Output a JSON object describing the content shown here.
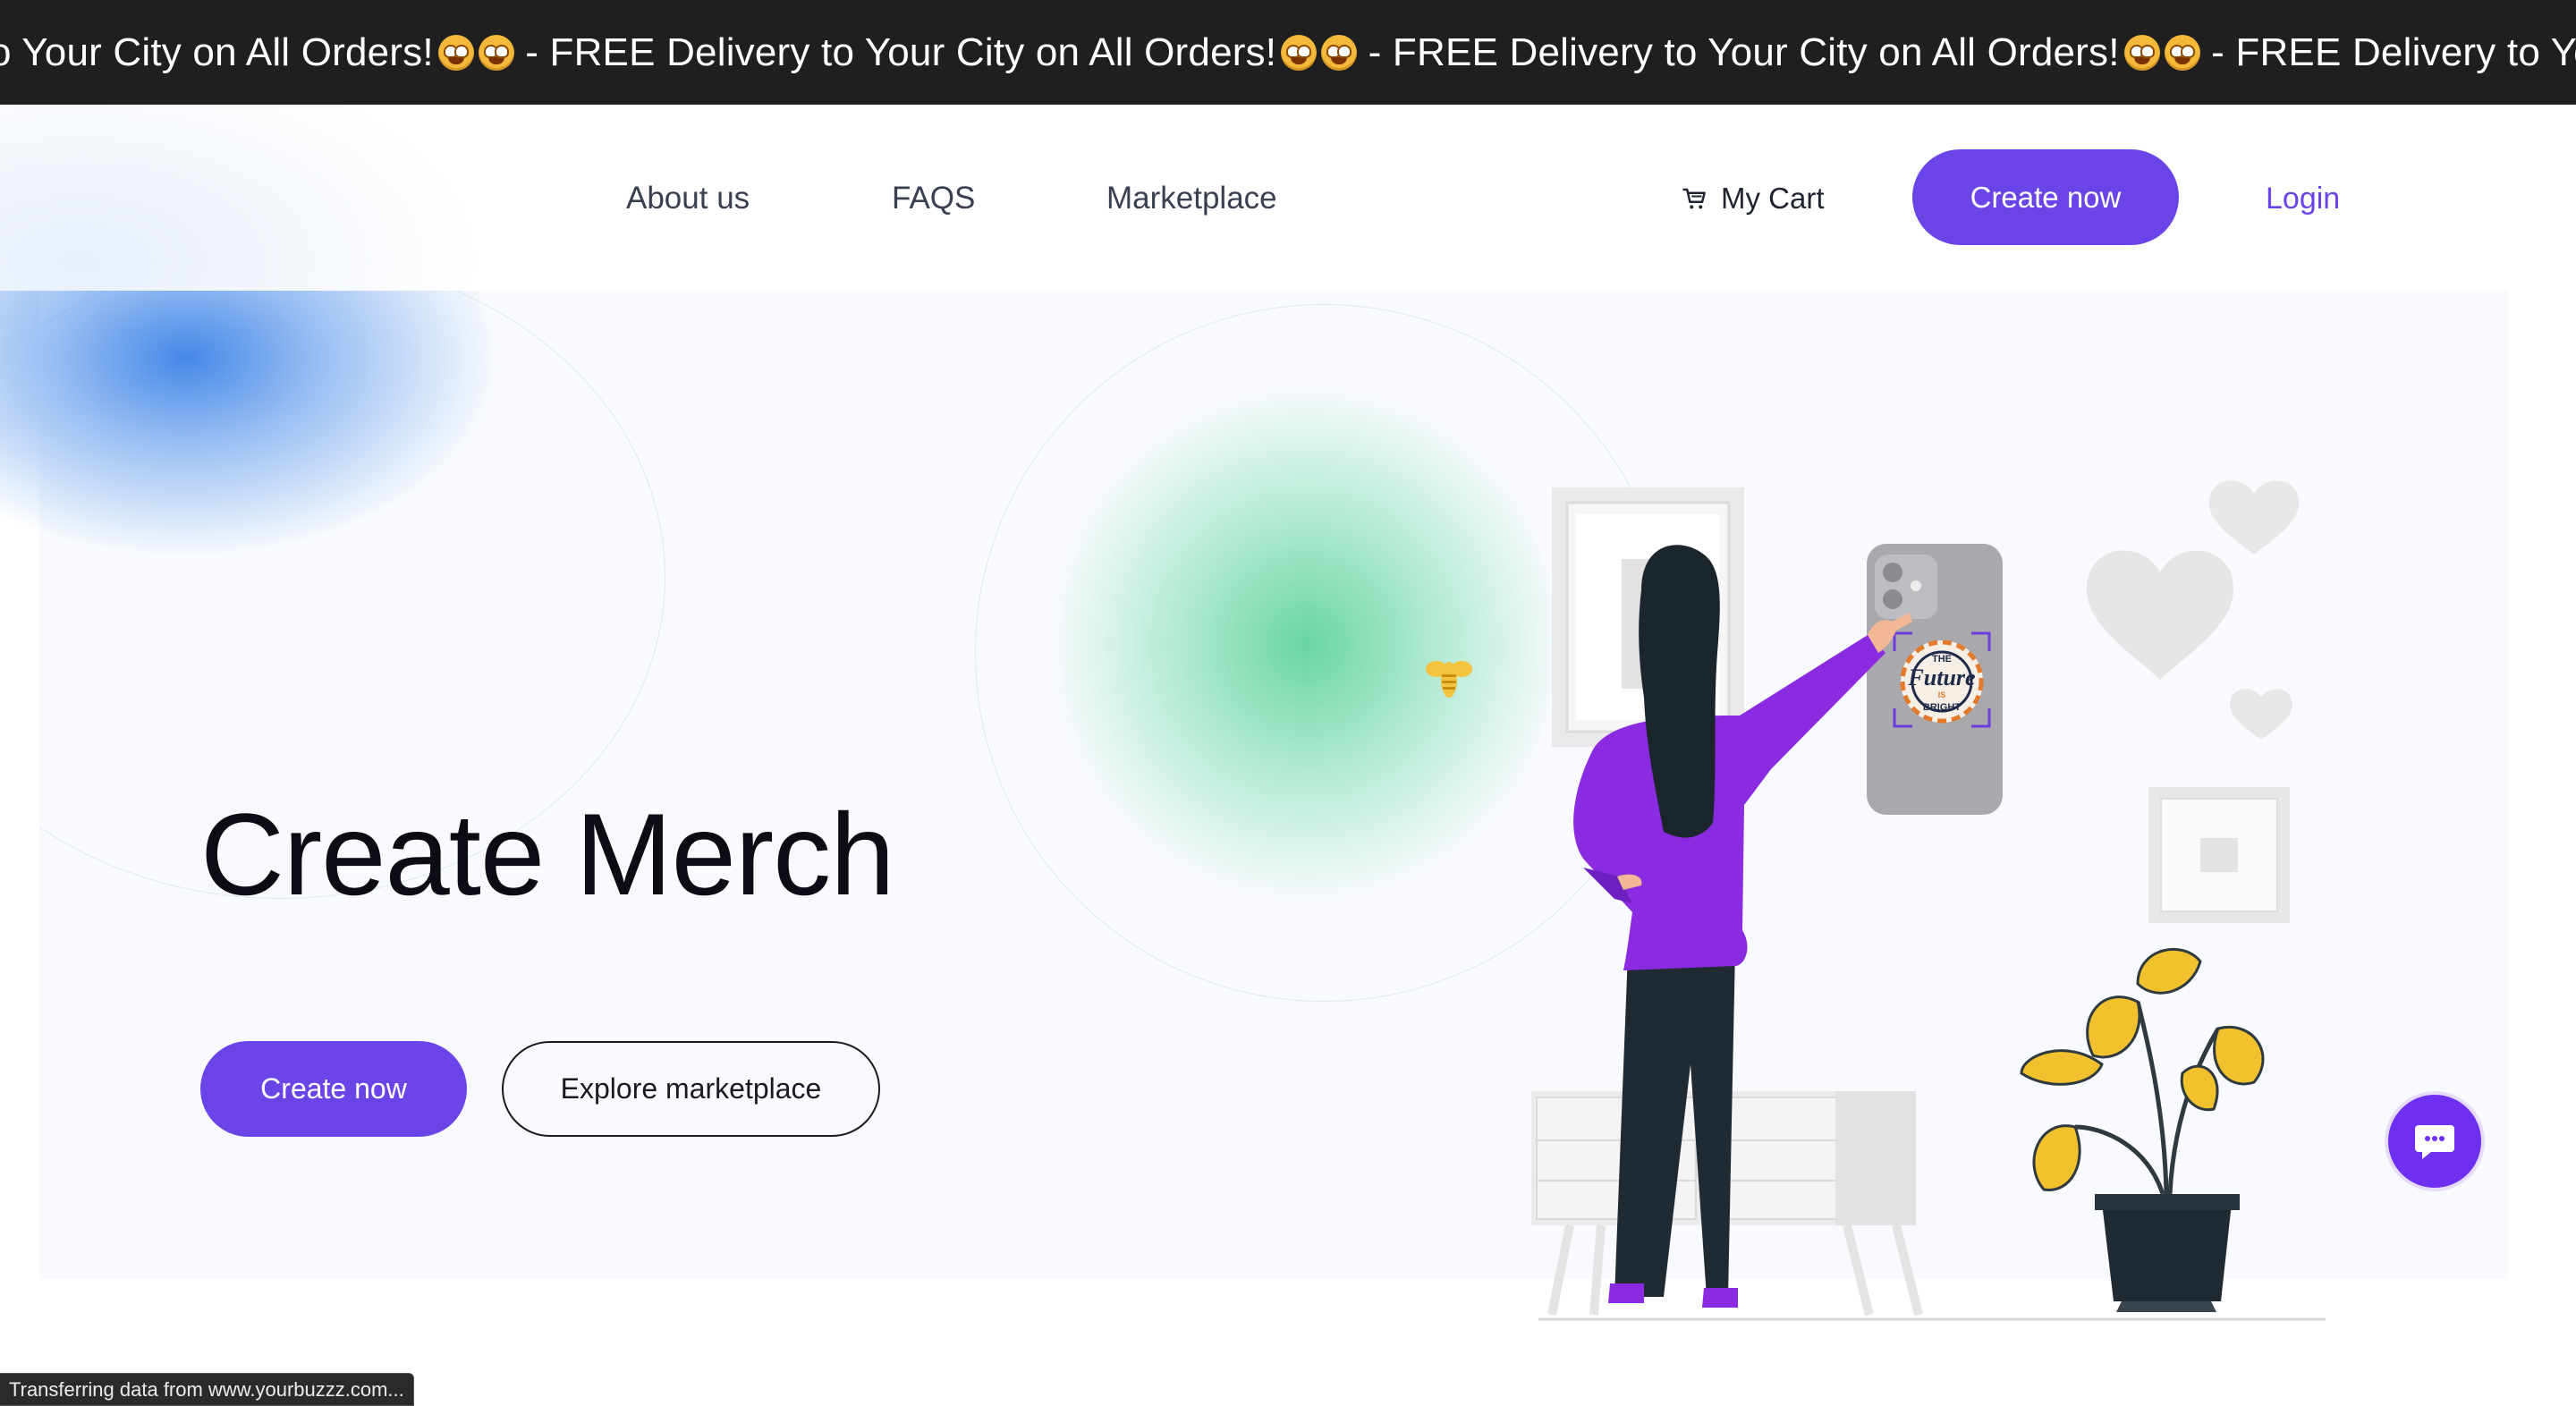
{
  "banner": {
    "segments": [
      "o Your City on All Orders!",
      " - FREE Delivery to Your City on All Orders!",
      " - FREE Delivery to Your City on All Orders!",
      " - FREE Delivery to Yo"
    ],
    "emoji_icon": "star-struck-emoji"
  },
  "nav": {
    "about": "About us",
    "faqs": "FAQS",
    "marketplace": "Marketplace",
    "cart": "My Cart",
    "create": "Create now",
    "login": "Login"
  },
  "hero": {
    "title": "Create Merch",
    "primary_button": "Create now",
    "secondary_button": "Explore marketplace"
  },
  "illustration": {
    "phone_sticker_text_top": "THE",
    "phone_sticker_text_main": "Future",
    "phone_sticker_text_mid": "IS",
    "phone_sticker_text_bottom": "BRIGHT"
  },
  "status_bar": "Transferring data from www.yourbuzzz.com...",
  "colors": {
    "accent": "#6b44e8",
    "banner_bg": "#1f1f1f",
    "chat_button": "#6f2ff0",
    "figure_jacket": "#8a2be2",
    "plant_leaves": "#f2c12e"
  }
}
